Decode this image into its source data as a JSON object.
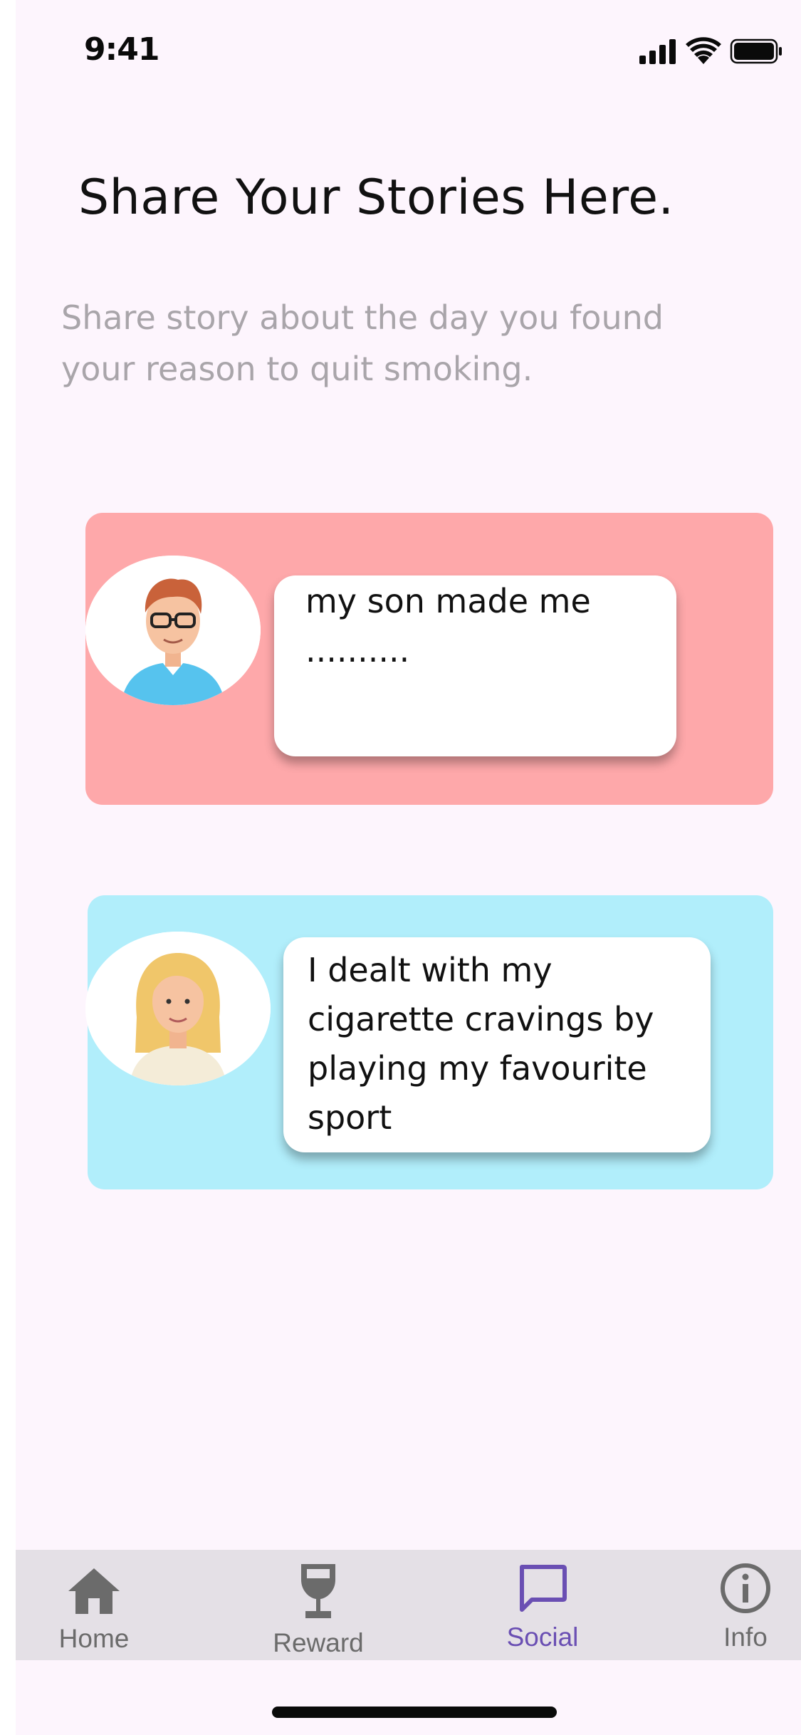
{
  "status_bar": {
    "time": "9:41",
    "icons": [
      "cellular-signal-icon",
      "wifi-icon",
      "battery-icon"
    ]
  },
  "header": {
    "title": "Share Your Stories Here.",
    "subtitle": "Share story about the day you found your reason to quit smoking."
  },
  "stories": [
    {
      "avatar": "man-with-glasses-avatar",
      "text": "my son made me ..........",
      "card_color": "#fea8aa"
    },
    {
      "avatar": "blonde-woman-avatar",
      "text": "I dealt with my cigarette cravings by playing my favourite sport",
      "card_color": "#b1eefb"
    }
  ],
  "tabbar": {
    "items": [
      {
        "label": "Home",
        "icon": "home-icon",
        "active": false
      },
      {
        "label": "Reward",
        "icon": "wine-glass-icon",
        "active": false
      },
      {
        "label": "Social",
        "icon": "chat-bubble-icon",
        "active": true
      },
      {
        "label": "Info",
        "icon": "info-icon",
        "active": false
      }
    ],
    "active_color": "#6a4fb3",
    "inactive_color": "#6b6b6b"
  }
}
